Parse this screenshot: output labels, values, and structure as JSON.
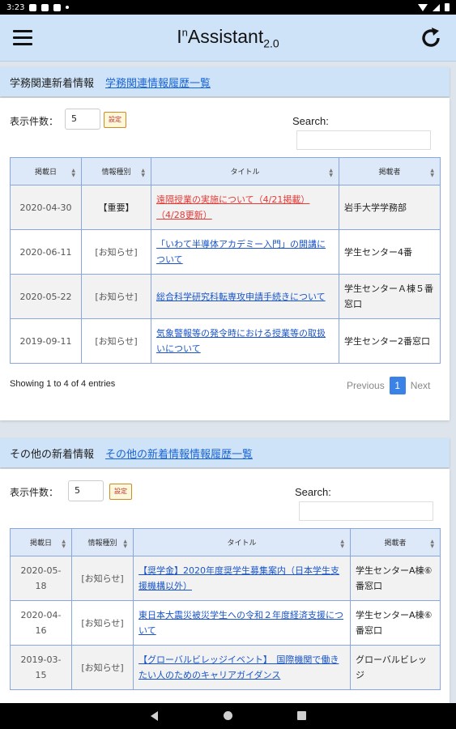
{
  "status_bar": {
    "time": "3:23"
  },
  "header": {
    "title_main": "I",
    "title_sup": "n",
    "title_word": "Assistant",
    "title_sub": "2.0"
  },
  "common": {
    "length_label": "表示件数：",
    "length_value": "5",
    "set_button": "設定",
    "search_label": "Search:",
    "columns": [
      "掲載日",
      "情報種別",
      "タイトル",
      "掲載者"
    ]
  },
  "academic": {
    "title": "学務関連新着情報",
    "history_link": "学務関連情報履歴一覧",
    "rows": [
      {
        "date": "2020-04-30",
        "type": "【重要】",
        "title": "遠隔授業の実施について（4/21掲載）（4/28更新）",
        "poster": "岩手大学学務部",
        "important": true
      },
      {
        "date": "2020-06-11",
        "type": "[お知らせ]",
        "title": "「いわて半導体アカデミー入門」の開講について",
        "poster": "学生センター4番",
        "important": false
      },
      {
        "date": "2020-05-22",
        "type": "[お知らせ]",
        "title": "総合科学研究科転専攻申請手続きについて",
        "poster": "学生センターＡ棟５番窓口",
        "important": false
      },
      {
        "date": "2019-09-11",
        "type": "[お知らせ]",
        "title": "気象警報等の発令時における授業等の取扱いについて",
        "poster": "学生センター2番窓口",
        "important": false
      }
    ],
    "info": "Showing 1 to 4 of 4 entries",
    "pager": {
      "previous": "Previous",
      "page": "1",
      "next": "Next"
    }
  },
  "other": {
    "title": "その他の新着情報",
    "history_link": "その他の新着情報情報履歴一覧",
    "rows": [
      {
        "date": "2020-05-18",
        "type": "[お知らせ]",
        "title": "【奨学金】2020年度奨学生募集案内（日本学生支援機構以外）",
        "poster": "学生センターA棟⑥番窓口"
      },
      {
        "date": "2020-04-16",
        "type": "[お知らせ]",
        "title": "東日本大震災被災学生への令和２年度経済支援について",
        "poster": "学生センターA棟⑥番窓口"
      },
      {
        "date": "2019-03-15",
        "type": "[お知らせ]",
        "title": "【グローバルビレッジイベント】　国際機関で働きたい人のためのキャリアガイダンス",
        "poster": "グローバルビレッジ"
      }
    ]
  },
  "colors": {
    "header_bg": "#cfe3f8",
    "link": "#1a55c8",
    "important": "#e53935",
    "page_active": "#3b82e6"
  }
}
